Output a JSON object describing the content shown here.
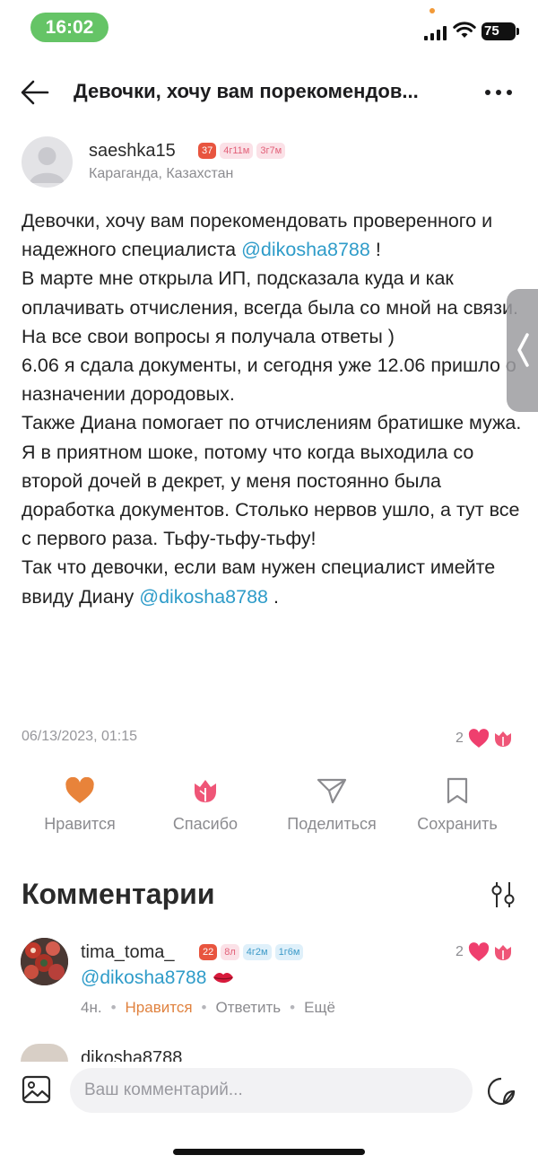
{
  "status_bar": {
    "time": "16:02",
    "battery": "75"
  },
  "header": {
    "title": "Девочки, хочу вам порекомендов..."
  },
  "post": {
    "author": "saeshka15",
    "badges": [
      "37",
      "4г11м",
      "3г7м"
    ],
    "city": "Караганда, Казахстан",
    "body": {
      "p1": "Девочки, хочу вам порекомендовать проверенного и надежного специалиста ",
      "mention1": "@dikosha8788",
      "p1_end": " !",
      "p2": "В марте мне открыла ИП, подсказала куда и как оплачивать отчисления, всегда была со мной на связи. На все свои вопросы я получала ответы )",
      "p3": "6.06 я сдала документы, и сегодня уже 12.06 пришло о назначении дородовых.",
      "p4": "Также Диана помогает по отчислениям братишке мужа.",
      "p5": "Я в приятном шоке, потому что когда выходила со второй дочей в декрет, у меня постоянно была доработка документов. Столько нервов ушло, а тут все с первого раза. Тьфу-тьфу-тьфу!",
      "p6": "Так что девочки, если вам нужен специалист имейте ввиду Диану ",
      "mention2": "@dikosha8788",
      "p6_end": " ."
    },
    "date": "06/13/2023, 01:15",
    "reaction_count": "2"
  },
  "actions": {
    "like": "Нравится",
    "thanks": "Спасибо",
    "share": "Поделиться",
    "save": "Сохранить"
  },
  "comments": {
    "title": "Комментарии",
    "items": [
      {
        "author": "tima_toma_",
        "badges": [
          "22",
          "8л",
          "4г2м",
          "1г6м"
        ],
        "mention": "@dikosha8788",
        "time": "4н.",
        "like": "Нравится",
        "reply": "Ответить",
        "more": "Ещё",
        "reaction_count": "2"
      },
      {
        "author": "dikosha8788"
      }
    ]
  },
  "input": {
    "placeholder": "Ваш комментарий..."
  },
  "colors": {
    "accent_orange": "#e0823f",
    "heart_pink": "#ef3f6e",
    "mention_blue": "#2f9cc9",
    "status_green": "#65c466"
  }
}
